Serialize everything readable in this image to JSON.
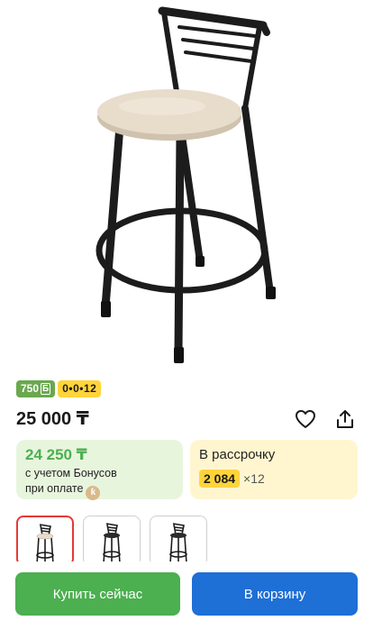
{
  "product": {
    "image_alt": "chair-photo"
  },
  "badges": {
    "bonus_amount": "750",
    "bonus_currency": "Б",
    "installment": "0•0•12"
  },
  "price": {
    "main": "25 000 ₸"
  },
  "bonus_card": {
    "price": "24 250 ₸",
    "line1": "с учетом Бонусов",
    "line2": "при оплате"
  },
  "installment_card": {
    "title": "В рассрочку",
    "amount": "2 084",
    "multiplier": "×12"
  },
  "thumbnails": [
    {
      "seat_color": "#e8dccb",
      "active": true
    },
    {
      "seat_color": "#2b2b2b",
      "active": false
    },
    {
      "seat_color": "#2b2b2b",
      "active": false
    }
  ],
  "buttons": {
    "buy": "Купить сейчас",
    "cart": "В корзину"
  },
  "colors": {
    "green": "#4caf50",
    "blue": "#1e6fd6",
    "yellow": "#ffd43b",
    "frame": "#1c1c1c",
    "seat": "#e8dccb"
  }
}
